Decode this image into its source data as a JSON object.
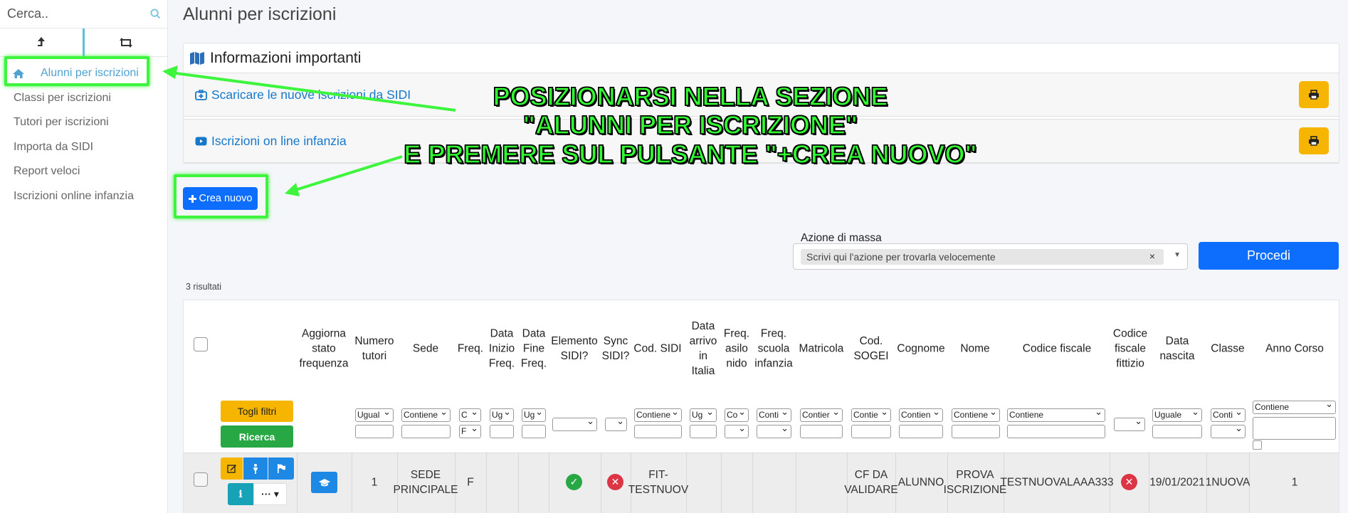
{
  "sidebar": {
    "search_placeholder": "Cerca..",
    "items": [
      {
        "label": "Alunni per iscrizioni"
      },
      {
        "label": "Classi per iscrizioni"
      },
      {
        "label": "Tutori per iscrizioni"
      },
      {
        "label": "Importa da SIDI"
      },
      {
        "label": "Report veloci"
      },
      {
        "label": "Iscrizioni online infanzia"
      }
    ]
  },
  "page": {
    "title": "Alunni per iscrizioni"
  },
  "info": {
    "title": "Informazioni importanti",
    "links": [
      {
        "label": "Scaricare le nuove iscrizioni da SIDI"
      },
      {
        "label": "Iscrizioni on line infanzia"
      }
    ]
  },
  "create_label": "Crea nuovo",
  "mass": {
    "label": "Azione di massa",
    "placeholder": "Scrivi qui l'azione per trovarla velocemente",
    "button": "Procedi"
  },
  "results_text": "3 risultati",
  "filters": {
    "clear": "Togli filtri",
    "search": "Ricerca"
  },
  "headers": {
    "aggiorna": [
      "Aggiorna",
      "stato",
      "frequenza"
    ],
    "numero_tutori": [
      "Numero",
      "tutori"
    ],
    "sede": [
      "Sede"
    ],
    "freq": [
      "Freq."
    ],
    "data_inizio": [
      "Data",
      "Inizio",
      "Freq."
    ],
    "data_fine": [
      "Data",
      "Fine",
      "Freq."
    ],
    "elemento_sidi": [
      "Elemento",
      "SIDI?"
    ],
    "sync_sidi": [
      "Sync",
      "SIDI?"
    ],
    "cod_sidi": [
      "Cod. SIDI"
    ],
    "data_arrivo": [
      "Data",
      "arrivo",
      "in",
      "Italia"
    ],
    "freq_asilo": [
      "Freq.",
      "asilo",
      "nido"
    ],
    "freq_scuola": [
      "Freq.",
      "scuola",
      "infanzia"
    ],
    "matricola": [
      "Matricola"
    ],
    "cod_sogei": [
      "Cod.",
      "SOGEI"
    ],
    "cognome": [
      "Cognome"
    ],
    "nome": [
      "Nome"
    ],
    "codice_fiscale": [
      "Codice fiscale"
    ],
    "cf_fittizio": [
      "Codice",
      "fiscale",
      "fittizio"
    ],
    "data_nascita": [
      "Data",
      "nascita"
    ],
    "classe": [
      "Classe"
    ],
    "anno_corso": [
      "Anno Corso"
    ]
  },
  "filter_values": {
    "numero_tutori": "Ugual",
    "sede": "Contiene",
    "freq_a": "C",
    "freq_b": "F",
    "data_inizio": "Ug",
    "data_fine": "Ug",
    "cod_sidi": "Contiene",
    "data_arrivo": "Ug",
    "freq_asilo": "Co",
    "freq_scuola": "Conti",
    "matricola": "Contier",
    "cod_sogei": "Contie",
    "cognome": "Contien",
    "nome": "Contiene",
    "codice_fiscale": "Contiene",
    "data_nascita": "Uguale",
    "classe": "Conti",
    "anno_corso": "Contiene"
  },
  "row": {
    "numero_tutori": "1",
    "sede": [
      "SEDE",
      "PRINCIPALE"
    ],
    "freq": "F",
    "cod_sidi": [
      "FIT-",
      "TESTNUOV"
    ],
    "cod_sogei": [
      "CF DA",
      "VALIDARE"
    ],
    "cognome": "ALUNNO",
    "nome": [
      "PROVA",
      "ISCRIZIONE"
    ],
    "codice_fiscale": "TESTNUOVALAAA333",
    "data_nascita": "19/01/2021",
    "classe": "1NUOVA",
    "anno_corso": "1"
  },
  "annotation": {
    "lines": [
      "POSIZIONARSI NELLA SEZIONE",
      "\"ALUNNI PER ISCRIZIONE\"",
      "E PREMERE SUL PULSANTE \"+CREA NUOVO\""
    ],
    "color": "#32ff32"
  },
  "colors": {
    "primary": "#0d6efd",
    "warning": "#f5b500",
    "success": "#28a745",
    "danger": "#dc3545",
    "info": "#17a2b8",
    "highlight": "#3df53d"
  }
}
